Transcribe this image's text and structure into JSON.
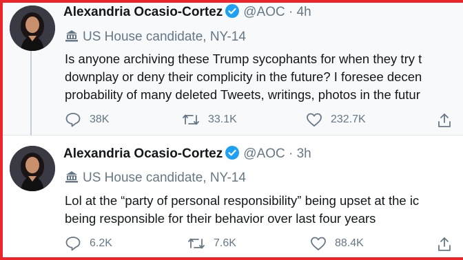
{
  "tweets": [
    {
      "name": "Alexandria Ocasio-Cortez",
      "handle": "@AOC",
      "separator": "·",
      "time": "4h",
      "bio": "US House candidate, NY-14",
      "text_lines": [
        "Is anyone archiving these Trump sycophants for when they try t",
        "downplay or deny their complicity in the future? I foresee decen",
        "probability of many deleted Tweets, writings, photos in the futur"
      ],
      "replies": "38K",
      "retweets": "33.1K",
      "likes": "232.7K"
    },
    {
      "name": "Alexandria Ocasio-Cortez",
      "handle": "@AOC",
      "separator": "·",
      "time": "3h",
      "bio": "US House candidate, NY-14",
      "text_lines": [
        "Lol at the “party of personal responsibility” being upset at the ic",
        "being responsible for their behavior over last four years"
      ],
      "replies": "6.2K",
      "retweets": "7.6K",
      "likes": "88.4K"
    }
  ],
  "icons": {
    "verified": "verified-badge-icon",
    "bio": "government-building-icon",
    "reply": "reply-icon",
    "retweet": "retweet-icon",
    "like": "heart-icon",
    "share": "share-icon"
  },
  "colors": {
    "frame": "#e8262b",
    "verified": "#1da1f2",
    "secondary_text": "#657786",
    "primary_text": "#14171a",
    "highlight_bg": "#f7f9fa"
  }
}
